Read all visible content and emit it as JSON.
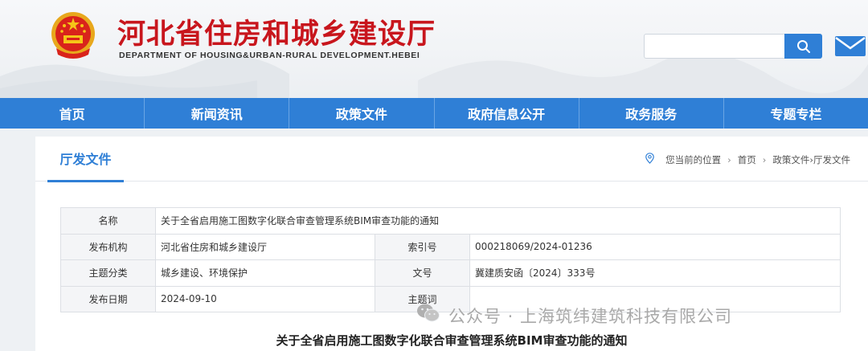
{
  "header": {
    "title": "河北省住房和城乡建设厅",
    "subtitle": "DEPARTMENT OF HOUSING&URBAN-RURAL DEVELOPMENT.HEBEI",
    "search": {
      "value": "",
      "placeholder": ""
    },
    "icons": {
      "emblem": "national-emblem-icon",
      "search": "search-icon",
      "mail": "mail-icon"
    },
    "colors": {
      "title": "#c8161d",
      "accent": "#2f7fd6"
    }
  },
  "nav": {
    "items": [
      {
        "label": "首页"
      },
      {
        "label": "新闻资讯"
      },
      {
        "label": "政策文件"
      },
      {
        "label": "政府信息公开"
      },
      {
        "label": "政务服务"
      },
      {
        "label": "专题专栏"
      }
    ]
  },
  "section": {
    "title": "厅发文件",
    "breadcrumb": {
      "prefix": "您当前的位置",
      "items": [
        "首页",
        "政策文件›厅发文件"
      ]
    }
  },
  "info": {
    "name_label": "名称",
    "name_value": "关于全省启用施工图数字化联合审查管理系统BIM审查功能的通知",
    "rows": [
      {
        "label1": "发布机构",
        "value1": "河北省住房和城乡建设厅",
        "label2": "索引号",
        "value2": "000218069/2024-01236"
      },
      {
        "label1": "主题分类",
        "value1": "城乡建设、环境保护",
        "label2": "文号",
        "value2": "冀建质安函〔2024〕333号"
      },
      {
        "label1": "发布日期",
        "value1": "2024-09-10",
        "label2": "主题词",
        "value2": ""
      }
    ]
  },
  "document": {
    "title": "关于全省启用施工图数字化联合审查管理系统BIM审查功能的通知"
  },
  "watermark": {
    "text": "公众号 · 上海筑纬建筑科技有限公司",
    "icon": "wechat-icon"
  }
}
